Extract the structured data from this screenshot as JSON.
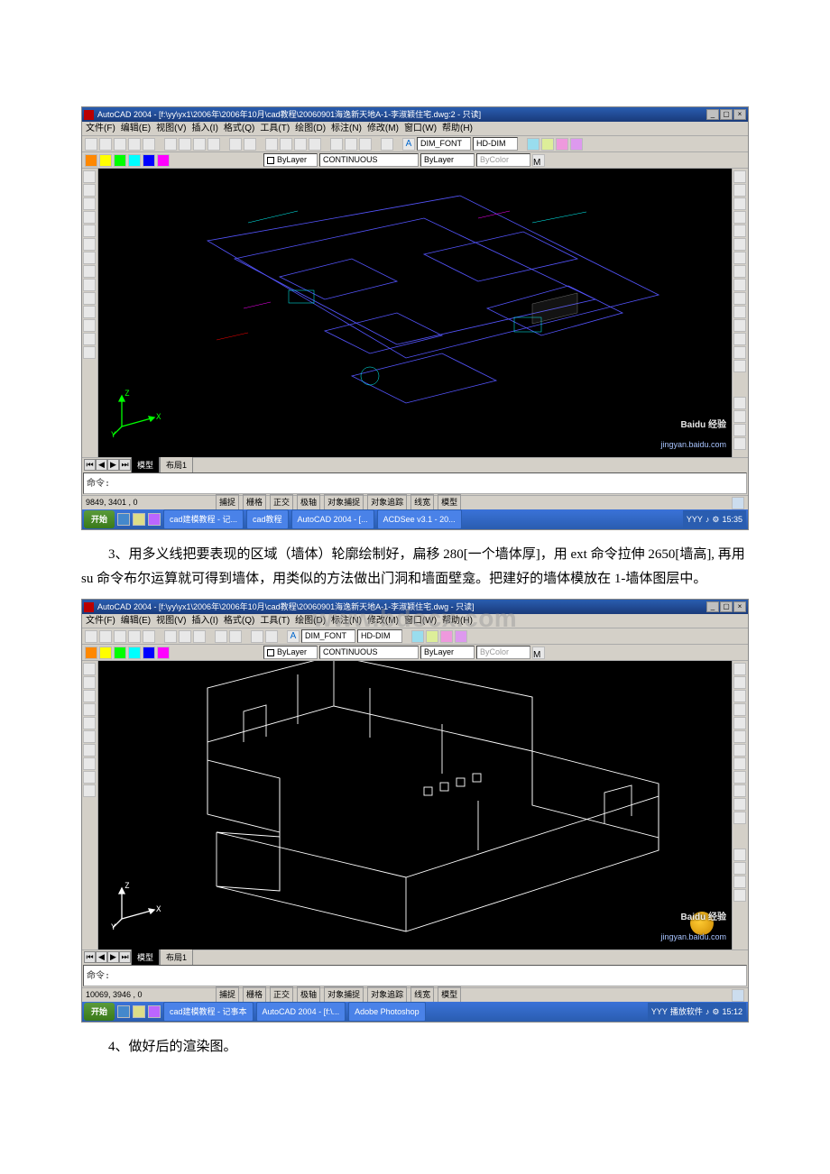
{
  "doc": {
    "watermark_text": "www.bdocx.com"
  },
  "paragraph3": "3、用多义线把要表现的区域（墙体）轮廓绘制好，扁移 280[一个墙体厚]，用 ext 命令拉伸 2650[墙高], 再用 su 命令布尔运算就可得到墙体，用类似的方法做出门洞和墙面壁龛。把建好的墙体模放在 1-墙体图层中。",
  "paragraph4": "4、做好后的渲染图。",
  "shot1": {
    "title": "AutoCAD 2004 - [f:\\yy\\yx1\\2006年\\2006年10月\\cad教程\\20060901海逸新天地A-1-李淑颖住宅.dwg:2 - 只读]",
    "menus": [
      "文件(F)",
      "编辑(E)",
      "视图(V)",
      "插入(I)",
      "格式(Q)",
      "工具(T)",
      "绘图(D)",
      "标注(N)",
      "修改(M)",
      "窗口(W)",
      "帮助(H)"
    ],
    "layer_combo": "ByLayer",
    "font_combo": "DIM_FONT",
    "dimstyle": "HD-DIM",
    "linetype": "CONTINUOUS",
    "lineweight": "ByLayer",
    "plotstyle": "ByColor",
    "tab_model": "模型",
    "tab_layout": "布局1",
    "coords": "9849, 3401 , 0",
    "status_btns": [
      "捕捉",
      "栅格",
      "正交",
      "极轴",
      "对象捕捉",
      "对象追踪",
      "线宽",
      "模型"
    ],
    "taskbar_start": "开始",
    "taskbar_items": [
      "cad建模教程 - 记...",
      "cad教程",
      "AutoCAD 2004 - [...",
      "ACDSee v3.1 - 20..."
    ],
    "tray_text": "YYY",
    "clock": "15:35",
    "watermark_brand": "Baidu 经验",
    "watermark_url": "jingyan.baidu.com",
    "ucs_labels": {
      "x": "X",
      "y": "Y",
      "z": "Z"
    },
    "cmd_prompt": "命令:"
  },
  "shot2": {
    "title": "AutoCAD 2004 - [f:\\yy\\yx1\\2006年\\2006年10月\\cad教程\\20060901海逸新天地A-1-李淑颖住宅.dwg - 只读]",
    "menus": [
      "文件(F)",
      "编辑(E)",
      "视图(V)",
      "插入(I)",
      "格式(Q)",
      "工具(T)",
      "绘图(D)",
      "标注(N)",
      "修改(M)",
      "窗口(W)",
      "帮助(H)"
    ],
    "layer_combo": "ByLayer",
    "font_combo": "DIM_FONT",
    "dimstyle": "HD-DIM",
    "linetype": "CONTINUOUS",
    "lineweight": "ByLayer",
    "plotstyle": "ByColor",
    "tab_model": "模型",
    "tab_layout": "布局1",
    "coords": "10069, 3946 , 0",
    "status_btns": [
      "捕捉",
      "栅格",
      "正交",
      "极轴",
      "对象捕捉",
      "对象追踪",
      "线宽",
      "模型"
    ],
    "taskbar_start": "开始",
    "taskbar_items": [
      "cad建模教程 - 记事本",
      "AutoCAD 2004 - [f:\\...",
      "Adobe Photoshop"
    ],
    "tray_text": "YYY",
    "tray_extra": "播放软件",
    "clock": "15:12",
    "watermark_brand": "Baidu 经验",
    "watermark_url": "jingyan.baidu.com",
    "ucs_labels": {
      "x": "X",
      "y": "Y",
      "z": "Z"
    },
    "cmd_prompt": "命令:"
  }
}
